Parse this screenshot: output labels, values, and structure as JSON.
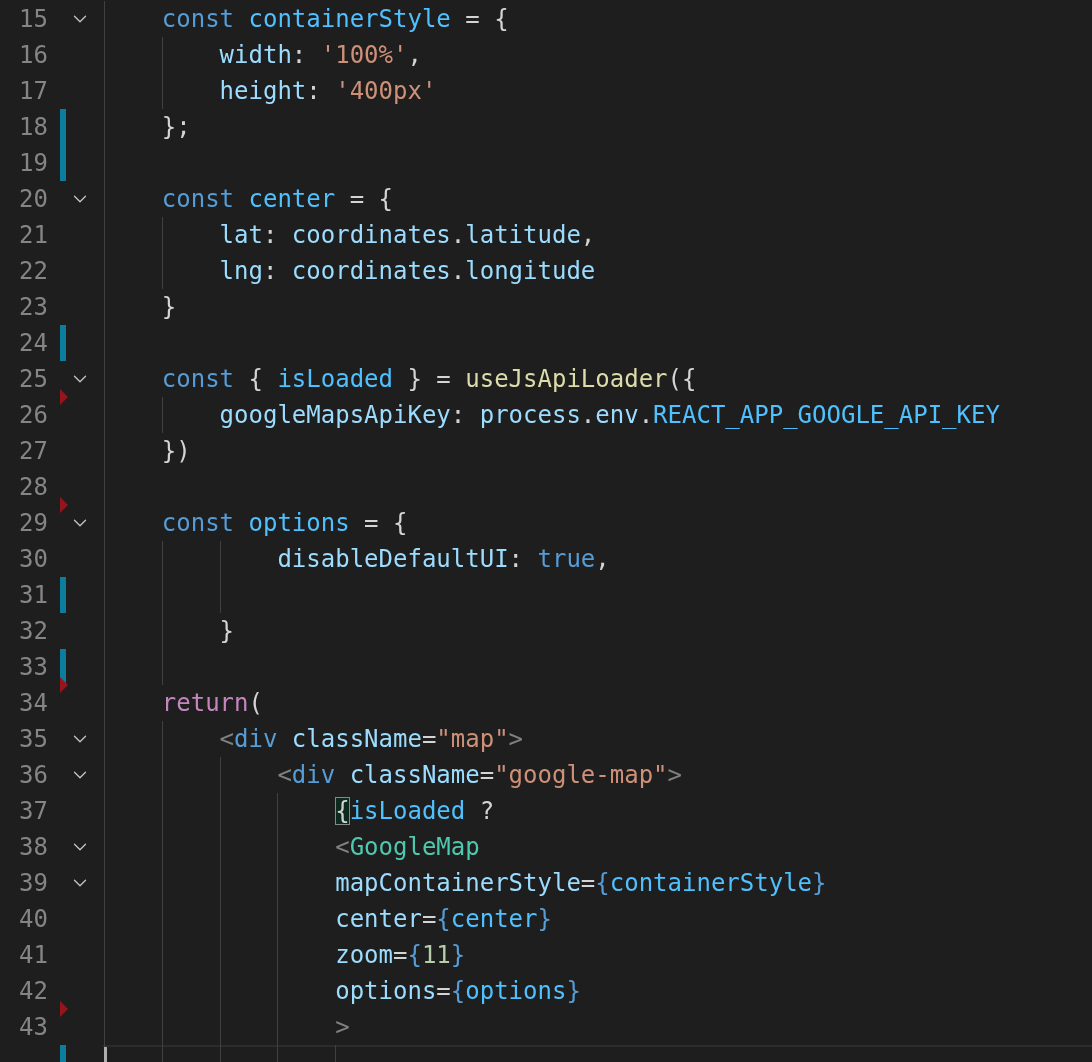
{
  "editor": {
    "lines": [
      {
        "number": "15",
        "foldable": true,
        "modified": false,
        "deleted": false,
        "current": false,
        "tokens": [
          {
            "text": "    const ",
            "kind": "kw"
          },
          {
            "text": "containerStyle",
            "kind": "const"
          },
          {
            "text": " = {",
            "kind": "punc"
          }
        ]
      },
      {
        "number": "16",
        "foldable": false,
        "modified": false,
        "deleted": false,
        "current": false,
        "tokens": [
          {
            "text": "        width",
            "kind": "prop"
          },
          {
            "text": ": ",
            "kind": "punc"
          },
          {
            "text": "'100%'",
            "kind": "str"
          },
          {
            "text": ",",
            "kind": "punc"
          }
        ]
      },
      {
        "number": "17",
        "foldable": false,
        "modified": false,
        "deleted": false,
        "current": false,
        "tokens": [
          {
            "text": "        height",
            "kind": "prop"
          },
          {
            "text": ": ",
            "kind": "punc"
          },
          {
            "text": "'400px'",
            "kind": "str"
          }
        ]
      },
      {
        "number": "18",
        "foldable": false,
        "modified": true,
        "deleted": false,
        "current": false,
        "tokens": [
          {
            "text": "    };",
            "kind": "punc"
          }
        ]
      },
      {
        "number": "19",
        "foldable": false,
        "modified": true,
        "deleted": false,
        "current": false
      },
      {
        "number": "20",
        "foldable": true,
        "modified": false,
        "deleted": false,
        "current": false,
        "tokens": [
          {
            "text": "    const ",
            "kind": "kw"
          },
          {
            "text": "center",
            "kind": "const"
          },
          {
            "text": " = {",
            "kind": "punc"
          }
        ]
      },
      {
        "number": "21",
        "foldable": false,
        "modified": false,
        "deleted": false,
        "current": false,
        "tokens": [
          {
            "text": "        lat",
            "kind": "prop"
          },
          {
            "text": ": ",
            "kind": "punc"
          },
          {
            "text": "coordinates",
            "kind": "prop"
          },
          {
            "text": ".",
            "kind": "punc"
          },
          {
            "text": "latitude",
            "kind": "prop"
          },
          {
            "text": ",",
            "kind": "punc"
          }
        ]
      },
      {
        "number": "22",
        "foldable": false,
        "modified": false,
        "deleted": false,
        "current": false,
        "tokens": [
          {
            "text": "        lng",
            "kind": "prop"
          },
          {
            "text": ": ",
            "kind": "punc"
          },
          {
            "text": "coordinates",
            "kind": "prop"
          },
          {
            "text": ".",
            "kind": "punc"
          },
          {
            "text": "longitude",
            "kind": "prop"
          }
        ]
      },
      {
        "number": "23",
        "foldable": false,
        "modified": false,
        "deleted": false,
        "current": false,
        "tokens": [
          {
            "text": "    }",
            "kind": "punc"
          }
        ]
      },
      {
        "number": "24",
        "foldable": false,
        "modified": true,
        "deleted": false,
        "current": false
      },
      {
        "number": "25",
        "foldable": true,
        "modified": false,
        "deleted": true,
        "current": false,
        "tokens": [
          {
            "text": "    const ",
            "kind": "kw"
          },
          {
            "text": "{ ",
            "kind": "punc"
          },
          {
            "text": "isLoaded",
            "kind": "const"
          },
          {
            "text": " } = ",
            "kind": "punc"
          },
          {
            "text": "useJsApiLoader",
            "kind": "fn"
          },
          {
            "text": "({",
            "kind": "punc"
          }
        ]
      },
      {
        "number": "26",
        "foldable": false,
        "modified": false,
        "deleted": false,
        "current": false,
        "tokens": [
          {
            "text": "        googleMapsApiKey",
            "kind": "prop"
          },
          {
            "text": ": ",
            "kind": "punc"
          },
          {
            "text": "process",
            "kind": "prop"
          },
          {
            "text": ".",
            "kind": "punc"
          },
          {
            "text": "env",
            "kind": "prop"
          },
          {
            "text": ".",
            "kind": "punc"
          },
          {
            "text": "REACT_APP_GOOGLE_API_KEY",
            "kind": "const"
          }
        ]
      },
      {
        "number": "27",
        "foldable": false,
        "modified": false,
        "deleted": false,
        "current": false,
        "tokens": [
          {
            "text": "    })",
            "kind": "punc"
          }
        ]
      },
      {
        "number": "28",
        "foldable": false,
        "modified": false,
        "deleted": true,
        "current": false
      },
      {
        "number": "29",
        "foldable": true,
        "modified": false,
        "deleted": false,
        "current": false,
        "tokens": [
          {
            "text": "    const ",
            "kind": "kw"
          },
          {
            "text": "options",
            "kind": "const"
          },
          {
            "text": " = {",
            "kind": "punc"
          }
        ]
      },
      {
        "number": "30",
        "foldable": false,
        "modified": false,
        "deleted": false,
        "current": false,
        "tokens": [
          {
            "text": "            disableDefaultUI",
            "kind": "prop"
          },
          {
            "text": ": ",
            "kind": "punc"
          },
          {
            "text": "true",
            "kind": "kw"
          },
          {
            "text": ",",
            "kind": "punc"
          }
        ]
      },
      {
        "number": "31",
        "foldable": false,
        "modified": true,
        "deleted": false,
        "current": false
      },
      {
        "number": "32",
        "foldable": false,
        "modified": false,
        "deleted": false,
        "current": false,
        "tokens": [
          {
            "text": "        }",
            "kind": "punc"
          }
        ]
      },
      {
        "number": "33",
        "foldable": false,
        "modified": true,
        "deleted": true,
        "current": false
      },
      {
        "number": "34",
        "foldable": false,
        "modified": false,
        "deleted": false,
        "current": false,
        "tokens": [
          {
            "text": "    return",
            "kind": "ctrl"
          },
          {
            "text": "(",
            "kind": "punc"
          }
        ]
      },
      {
        "number": "35",
        "foldable": true,
        "modified": false,
        "deleted": false,
        "current": false,
        "tokens": [
          {
            "text": "        <",
            "kind": "tagp"
          },
          {
            "text": "div ",
            "kind": "tag"
          },
          {
            "text": "className",
            "kind": "prop"
          },
          {
            "text": "=",
            "kind": "punc"
          },
          {
            "text": "\"map\"",
            "kind": "str"
          },
          {
            "text": ">",
            "kind": "tagp"
          }
        ]
      },
      {
        "number": "36",
        "foldable": true,
        "modified": false,
        "deleted": false,
        "current": false,
        "tokens": [
          {
            "text": "            <",
            "kind": "tagp"
          },
          {
            "text": "div ",
            "kind": "tag"
          },
          {
            "text": "className",
            "kind": "prop"
          },
          {
            "text": "=",
            "kind": "punc"
          },
          {
            "text": "\"google-map\"",
            "kind": "str"
          },
          {
            "text": ">",
            "kind": "tagp"
          }
        ]
      },
      {
        "number": "37",
        "foldable": false,
        "modified": false,
        "deleted": false,
        "current": false,
        "tokens": [
          {
            "text": "                {",
            "kind": "match"
          },
          {
            "text": "isLoaded",
            "kind": "const"
          },
          {
            "text": " ?",
            "kind": "punc"
          }
        ]
      },
      {
        "number": "38",
        "foldable": true,
        "modified": false,
        "deleted": false,
        "current": false,
        "tokens": [
          {
            "text": "                <",
            "kind": "tagp"
          },
          {
            "text": "GoogleMap",
            "kind": "comp"
          }
        ]
      },
      {
        "number": "39",
        "foldable": true,
        "modified": false,
        "deleted": false,
        "current": false,
        "tokens": [
          {
            "text": "                mapContainerStyle",
            "kind": "prop"
          },
          {
            "text": "=",
            "kind": "punc"
          },
          {
            "text": "{",
            "kind": "brace"
          },
          {
            "text": "containerStyle",
            "kind": "const"
          },
          {
            "text": "}",
            "kind": "brace"
          }
        ]
      },
      {
        "number": "40",
        "foldable": false,
        "modified": false,
        "deleted": false,
        "current": false,
        "tokens": [
          {
            "text": "                center",
            "kind": "prop"
          },
          {
            "text": "=",
            "kind": "punc"
          },
          {
            "text": "{",
            "kind": "brace"
          },
          {
            "text": "center",
            "kind": "const"
          },
          {
            "text": "}",
            "kind": "brace"
          }
        ]
      },
      {
        "number": "41",
        "foldable": false,
        "modified": false,
        "deleted": false,
        "current": false,
        "tokens": [
          {
            "text": "                zoom",
            "kind": "prop"
          },
          {
            "text": "=",
            "kind": "punc"
          },
          {
            "text": "{",
            "kind": "brace"
          },
          {
            "text": "11",
            "kind": "num"
          },
          {
            "text": "}",
            "kind": "brace"
          }
        ]
      },
      {
        "number": "42",
        "foldable": false,
        "modified": false,
        "deleted": true,
        "current": false,
        "tokens": [
          {
            "text": "                options",
            "kind": "prop"
          },
          {
            "text": "=",
            "kind": "punc"
          },
          {
            "text": "{",
            "kind": "brace"
          },
          {
            "text": "options",
            "kind": "const"
          },
          {
            "text": "}",
            "kind": "brace"
          }
        ]
      },
      {
        "number": "43",
        "foldable": false,
        "modified": false,
        "deleted": false,
        "current": false,
        "tokens": [
          {
            "text": "                >",
            "kind": "tagp"
          }
        ]
      },
      {
        "foldable": false,
        "modified": true,
        "deleted": false,
        "current": true
      }
    ]
  }
}
